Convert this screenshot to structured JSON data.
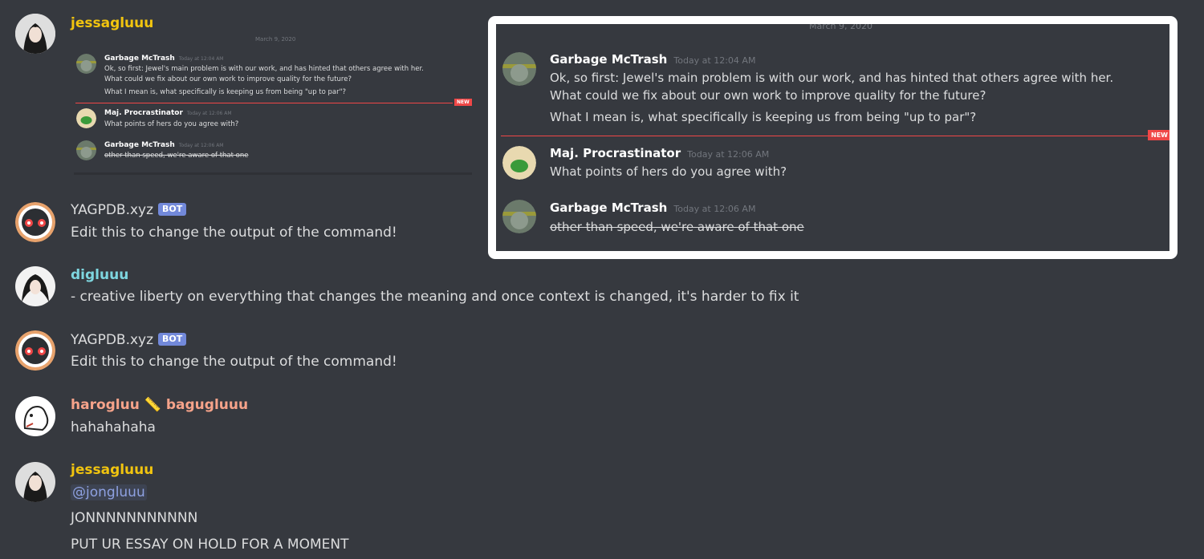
{
  "messages": [
    {
      "username": "jessagluuu",
      "username_color": "#f1c40f",
      "embedded_small": {
        "date": "March 9, 2020",
        "new_tag": "NEW",
        "entries": [
          {
            "name": "Garbage McTrash",
            "time": "Today at 12:04 AM",
            "lines": [
              "Ok, so first: Jewel's main problem is with our work, and has hinted that others agree with her.",
              "What could we fix about our own work to improve quality for the future?",
              "What I mean is, what specifically is keeping us from being \"up to par\"?"
            ]
          },
          {
            "name": "Maj. Procrastinator",
            "time": "Today at 12:06 AM",
            "lines": [
              "What points of hers do you agree with?"
            ]
          },
          {
            "name": "Garbage McTrash",
            "time": "Today at 12:06 AM",
            "lines": [
              "other than speed, we're aware of that one"
            ]
          }
        ]
      }
    },
    {
      "username": "YAGPDB.xyz",
      "badge": "BOT",
      "text": "Edit this to change the output of the command!"
    },
    {
      "username": "digluuu",
      "username_color": "#7ed6df",
      "text": "- creative liberty on everything that changes the meaning and once context is changed, it's harder to fix it"
    },
    {
      "username": "YAGPDB.xyz",
      "badge": "BOT",
      "text": "Edit this to change the output of the command!"
    },
    {
      "username": "harogluu",
      "username_emoji": "📏",
      "username_suffix": "bagugluuu",
      "username_color": "#f6a38a",
      "text": "hahahahaha"
    },
    {
      "username": "jessagluuu",
      "username_color": "#f1c40f",
      "mention": "@jongluuu",
      "lines": [
        "JONNNNNNNNNNN",
        "PUT UR ESSAY ON HOLD FOR A MOMENT"
      ]
    }
  ],
  "embedded_large": {
    "date": "March 9, 2020",
    "new_tag": "NEW",
    "entries": [
      {
        "name": "Garbage McTrash",
        "time": "Today at 12:04 AM",
        "lines": [
          "Ok, so first: Jewel's main problem is with our work, and has hinted that others agree with her.",
          "What could we fix about our own work to improve quality for the future?",
          "What I mean is, what specifically is keeping us from being \"up to par\"?"
        ]
      },
      {
        "name": "Maj. Procrastinator",
        "time": "Today at 12:06 AM",
        "lines": [
          "What points of hers do you agree with?"
        ]
      },
      {
        "name": "Garbage McTrash",
        "time": "Today at 12:06 AM",
        "lines": [
          "other than speed, we're aware of that one"
        ]
      }
    ]
  },
  "colors": {
    "background": "#36393f",
    "bot_badge": "#7289da",
    "new_line": "#f04747"
  }
}
